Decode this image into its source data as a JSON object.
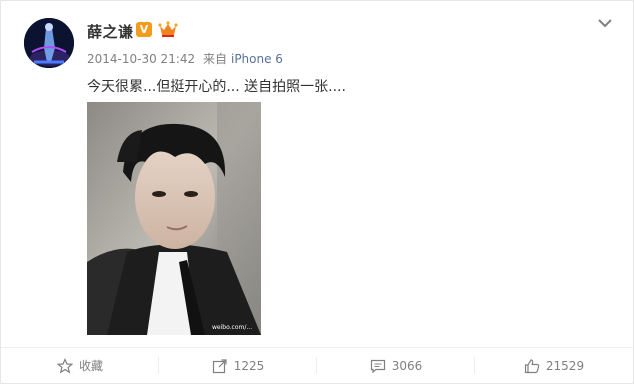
{
  "post": {
    "username": "薛之谦",
    "verified_badge": "V",
    "timestamp": "2014-10-30 21:42",
    "source_prefix": "来自",
    "device": "iPhone 6",
    "text": "今天很累...但挺开心的... 送自拍照一张....",
    "photo_watermark": "weibo.com/..."
  },
  "actions": {
    "favorite_label": "收藏",
    "repost_count": "1225",
    "comment_count": "3066",
    "like_count": "21529"
  },
  "icons": {
    "avatar": "avatar-image",
    "vip": "crown-icon",
    "expand": "chevron-down-icon",
    "favorite": "star-icon",
    "repost": "share-icon",
    "comment": "comment-icon",
    "like": "thumbs-up-icon"
  },
  "colors": {
    "verified_orange": "#f59b1b",
    "text_gray": "#808080",
    "device_link": "#5a7099"
  }
}
